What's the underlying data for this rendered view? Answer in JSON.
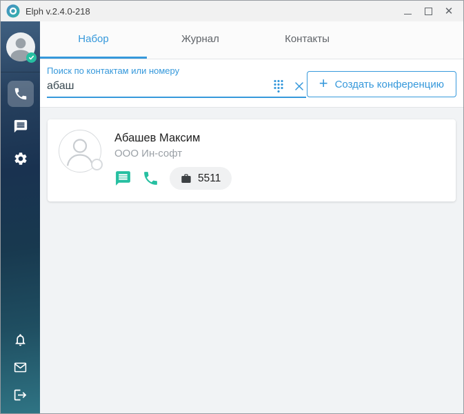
{
  "colors": {
    "accent_blue": "#3598db",
    "accent_teal": "#26bfa1",
    "sidebar_top": "#3e5c7b",
    "sidebar_bottom": "#2f7484",
    "content_bg": "#f1f3f5"
  },
  "titlebar": {
    "title": "Elph v.2.4.0-218"
  },
  "icons": {
    "logo": "elph-swirl-logo",
    "minimize": "minimize-line",
    "maximize": "maximize-square",
    "close": "✕",
    "avatar_status": "check-badge",
    "sidebar_nav": [
      "phone",
      "chat",
      "settings-gear"
    ],
    "sidebar_bottom": [
      "bell",
      "mail-envelope",
      "logout"
    ],
    "dialpad": "dialpad-dot-grid",
    "clear_search": "✕",
    "plus": "+",
    "contact_actions": [
      "chat-bubble",
      "phone"
    ],
    "extension": "briefcase"
  },
  "tabs": [
    {
      "label": "Набор",
      "active": true
    },
    {
      "label": "Журнал",
      "active": false
    },
    {
      "label": "Контакты",
      "active": false
    }
  ],
  "search": {
    "label": "Поиск по контактам или номеру",
    "value": "абаш"
  },
  "conference_button": {
    "plus": "+",
    "label": "Создать конференцию"
  },
  "results": [
    {
      "name": "Абашев Максим",
      "company": "ООО Ин-софт",
      "extension": "5511"
    }
  ]
}
